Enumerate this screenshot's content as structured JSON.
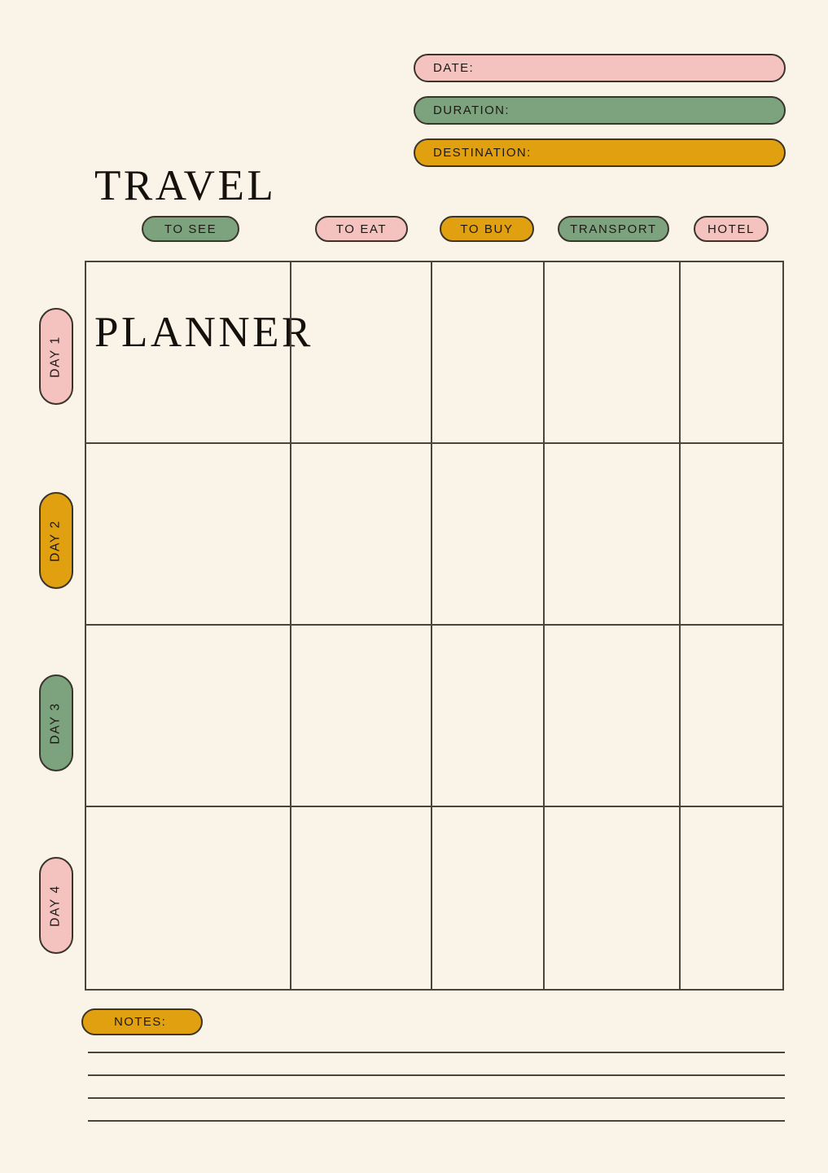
{
  "page": {
    "background_color": "#faf3e7",
    "ink_color": "#4a443a"
  },
  "palette": {
    "pink": "#f4c3c0",
    "green": "#7da37e",
    "gold": "#e0a010",
    "outline": "#3a342b"
  },
  "title": {
    "line1": "TRAVEL",
    "line2": "PLANNER"
  },
  "header_fields": [
    {
      "label": "DATE:",
      "color": "pink",
      "value": ""
    },
    {
      "label": "DURATION:",
      "color": "green",
      "value": ""
    },
    {
      "label": "DESTINATION:",
      "color": "gold",
      "value": ""
    }
  ],
  "columns": [
    {
      "label": "TO SEE",
      "color": "green"
    },
    {
      "label": "TO EAT",
      "color": "pink"
    },
    {
      "label": "TO BUY",
      "color": "gold"
    },
    {
      "label": "TRANSPORT",
      "color": "green"
    },
    {
      "label": "HOTEL",
      "color": "pink"
    }
  ],
  "days": [
    {
      "label": "DAY 1",
      "color": "pink"
    },
    {
      "label": "DAY 2",
      "color": "gold"
    },
    {
      "label": "DAY 3",
      "color": "green"
    },
    {
      "label": "DAY 4",
      "color": "pink"
    }
  ],
  "grid": {
    "rows": 4,
    "cols": 5,
    "cells": [
      [
        "",
        "",
        "",
        "",
        ""
      ],
      [
        "",
        "",
        "",
        "",
        ""
      ],
      [
        "",
        "",
        "",
        "",
        ""
      ],
      [
        "",
        "",
        "",
        "",
        ""
      ]
    ]
  },
  "notes": {
    "label": "NOTES:",
    "color": "gold",
    "lines": [
      "",
      "",
      "",
      ""
    ]
  }
}
